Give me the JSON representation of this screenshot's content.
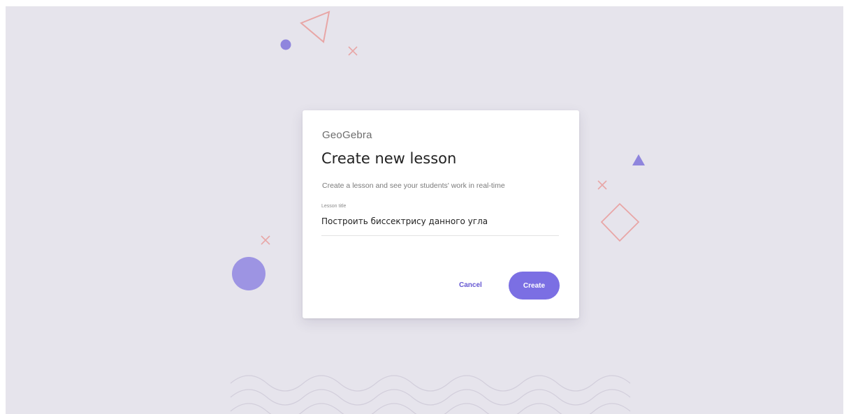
{
  "dialog": {
    "brand": "GeoGebra",
    "title": "Create new lesson",
    "subtitle": "Create a lesson and see your students' work in real-time",
    "field": {
      "label": "Lesson title",
      "value": "Построить биссектрису данного угла"
    },
    "cancel_label": "Cancel",
    "create_label": "Create"
  },
  "colors": {
    "background": "#e6e4ec",
    "accent": "#7b6fe3",
    "accent_text": "#6557d2",
    "decor_pink": "#e8a6a6",
    "decor_purple": "#8f85dd"
  },
  "icons": {
    "decor": [
      "triangle-outline-icon",
      "dot-icon",
      "x-mark-icon",
      "filled-triangle-icon",
      "diamond-outline-icon",
      "large-circle-icon",
      "wave-pattern"
    ]
  }
}
